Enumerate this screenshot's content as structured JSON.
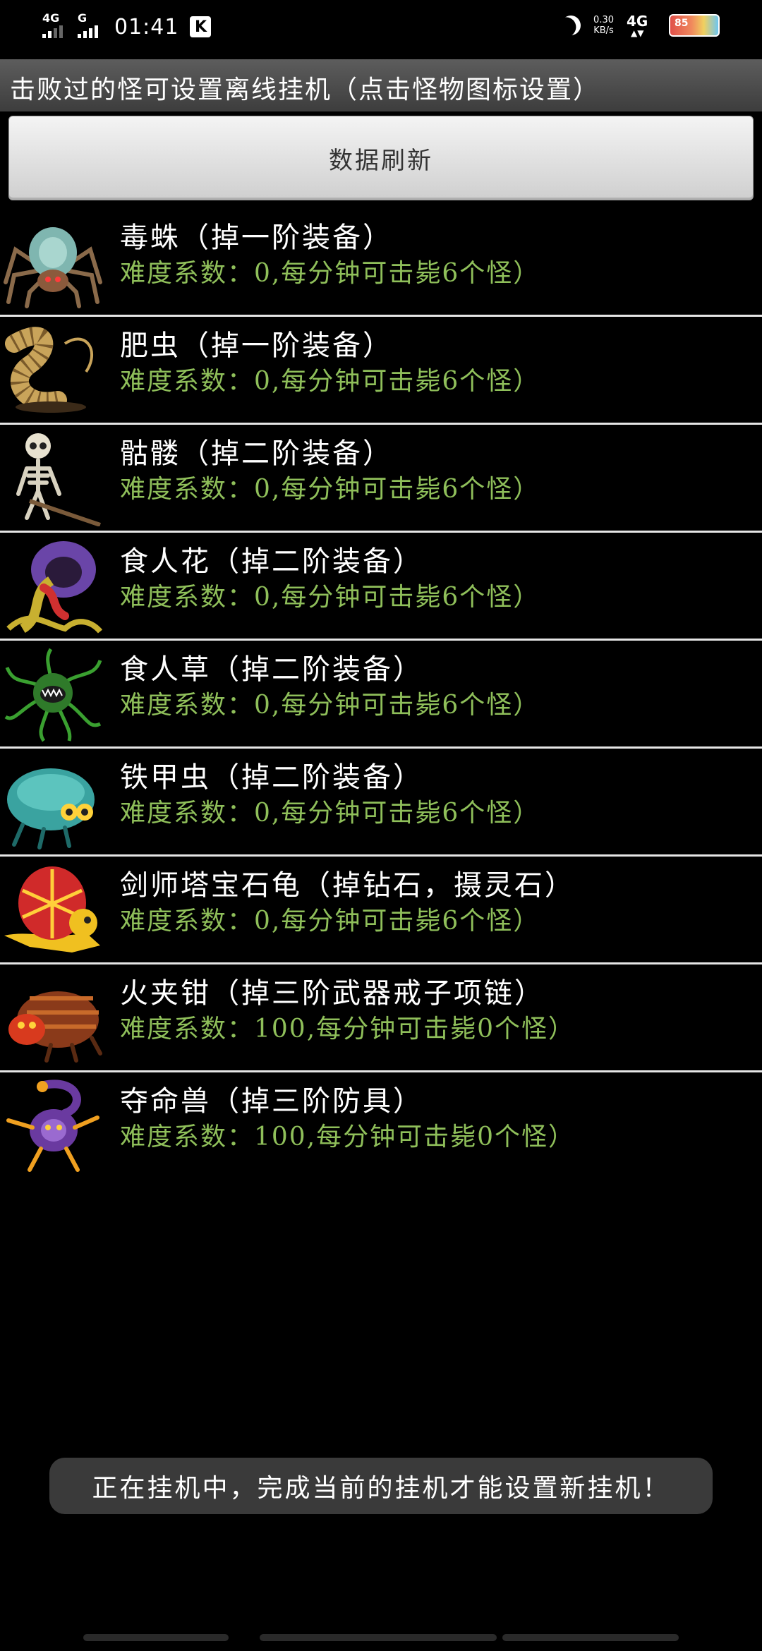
{
  "status_bar": {
    "sim1": "4G",
    "sim2": "G",
    "time": "01:41",
    "app_badge": "K",
    "speed_value": "0.30",
    "speed_unit": "KB/s",
    "network": "4G",
    "battery_level": "85"
  },
  "header": {
    "title": "击败过的怪可设置离线挂机（点击怪物图标设置）"
  },
  "toolbar": {
    "refresh_label": "数据刷新"
  },
  "monsters": [
    {
      "name": "毒蛛（掉一阶装备）",
      "info": "难度系数：0,每分钟可击毙6个怪）",
      "icon": "spider-icon",
      "color": "#7fb6b0"
    },
    {
      "name": "肥虫（掉一阶装备）",
      "info": "难度系数：0,每分钟可击毙6个怪）",
      "icon": "worm-icon",
      "color": "#c9a45a"
    },
    {
      "name": "骷髅（掉二阶装备）",
      "info": "难度系数：0,每分钟可击毙6个怪）",
      "icon": "skeleton-icon",
      "color": "#d8d2c0"
    },
    {
      "name": "食人花（掉二阶装备）",
      "info": "难度系数：0,每分钟可击毙6个怪）",
      "icon": "man-eating-flower-icon",
      "color": "#6a45a8"
    },
    {
      "name": "食人草（掉二阶装备）",
      "info": "难度系数：0,每分钟可击毙6个怪）",
      "icon": "man-eating-grass-icon",
      "color": "#2f7a2a"
    },
    {
      "name": "铁甲虫（掉二阶装备）",
      "info": "难度系数：0,每分钟可击毙6个怪）",
      "icon": "armored-beetle-icon",
      "color": "#3aa3a0"
    },
    {
      "name": "剑师塔宝石龟（掉钻石，摄灵石）",
      "info": "难度系数：0,每分钟可击毙6个怪）",
      "icon": "gem-turtle-icon",
      "color": "#d02a2a"
    },
    {
      "name": "火夹钳（掉三阶武器戒子项链）",
      "info": "难度系数：100,每分钟可击毙0个怪）",
      "icon": "fire-crab-icon",
      "color": "#c84a1e"
    },
    {
      "name": "夺命兽（掉三阶防具）",
      "info": "难度系数：100,每分钟可击毙0个怪）",
      "icon": "scorpion-beast-icon",
      "color": "#6a3aa0"
    }
  ],
  "toast": {
    "message": "正在挂机中，完成当前的挂机才能设置新挂机！"
  }
}
